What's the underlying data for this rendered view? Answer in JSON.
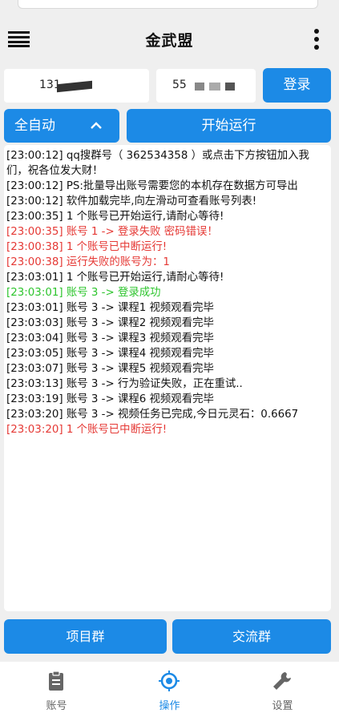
{
  "app": {
    "title": "金武盟"
  },
  "login": {
    "username": "131",
    "password": "55",
    "login_label": "登录"
  },
  "controls": {
    "mode_label": "全自动",
    "start_label": "开始运行"
  },
  "log": [
    {
      "text": "[23:00:12] qq搜群号（ 362534358 ）或点击下方按钮加入我们，祝各位发大财！",
      "color": "normal"
    },
    {
      "text": "[23:00:12] PS:批量导出账号需要您的本机存在数据方可导出",
      "color": "normal"
    },
    {
      "text": "[23:00:12] 软件加载完毕,向左滑动可查看账号列表!",
      "color": "normal"
    },
    {
      "text": "[23:00:35] 1 个账号已开始运行,请耐心等待!",
      "color": "normal"
    },
    {
      "text": "[23:00:35] 账号 1 -> 登录失败 密码错误！",
      "color": "red"
    },
    {
      "text": "[23:00:38] 1 个账号已中断运行!",
      "color": "red"
    },
    {
      "text": "[23:00:38] 运行失败的账号为：1",
      "color": "red"
    },
    {
      "text": "[23:03:01] 1 个账号已开始运行,请耐心等待!",
      "color": "normal"
    },
    {
      "text": "[23:03:01] 账号 3 -> 登录成功",
      "color": "green"
    },
    {
      "text": "[23:03:01] 账号 3 -> 课程1 视频观看完毕",
      "color": "normal"
    },
    {
      "text": "[23:03:03] 账号 3 -> 课程2 视频观看完毕",
      "color": "normal"
    },
    {
      "text": "[23:03:04] 账号 3 -> 课程3 视频观看完毕",
      "color": "normal"
    },
    {
      "text": "[23:03:05] 账号 3 -> 课程4 视频观看完毕",
      "color": "normal"
    },
    {
      "text": "[23:03:07] 账号 3 -> 课程5 视频观看完毕",
      "color": "normal"
    },
    {
      "text": "[23:03:13] 账号 3 -> 行为验证失败，正在重试..",
      "color": "normal"
    },
    {
      "text": "[23:03:19] 账号 3 -> 课程6 视频观看完毕",
      "color": "normal"
    },
    {
      "text": "[23:03:20] 账号 3 -> 视频任务已完成,今日元灵石：0.6667",
      "color": "normal"
    },
    {
      "text": "[23:03:20] 1 个账号已中断运行!",
      "color": "red"
    }
  ],
  "bottom_buttons": {
    "project_label": "项目群",
    "chat_label": "交流群"
  },
  "nav": [
    {
      "label": "账号",
      "icon": "clipboard-icon",
      "active": false
    },
    {
      "label": "操作",
      "icon": "target-icon",
      "active": true
    },
    {
      "label": "设置",
      "icon": "wrench-icon",
      "active": false
    }
  ],
  "colors": {
    "accent": "#1c8ae6",
    "error": "#e53935",
    "success": "#2ec52e",
    "background": "#efefef"
  }
}
